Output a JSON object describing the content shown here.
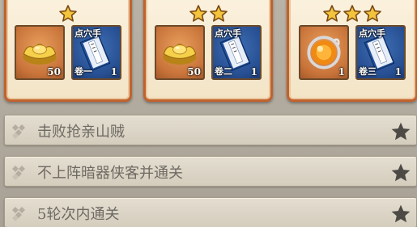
{
  "colors": {
    "card_border": "#c2612c",
    "star_gold": "#f3c43c",
    "task_text": "#6e6a63",
    "task_star": "#4d4a46"
  },
  "reward_cards": [
    {
      "stars": 1,
      "items": [
        {
          "icon": "gold-ingot-icon",
          "quantity": "50"
        },
        {
          "icon": "skill-book-icon",
          "tag": "点穴手",
          "subtitle": "卷一",
          "quantity": "1"
        }
      ]
    },
    {
      "stars": 2,
      "items": [
        {
          "icon": "gold-ingot-icon",
          "quantity": "50"
        },
        {
          "icon": "skill-book-icon",
          "tag": "点穴手",
          "subtitle": "卷二",
          "quantity": "1"
        }
      ]
    },
    {
      "stars": 3,
      "items": [
        {
          "icon": "orange-orb-icon",
          "quantity": "1"
        },
        {
          "icon": "skill-book-icon",
          "tag": "点穴手",
          "subtitle": "卷三",
          "quantity": "1"
        }
      ]
    }
  ],
  "tasks": [
    {
      "text": "击败抢亲山贼",
      "star_icon": "star-icon"
    },
    {
      "text": "不上阵暗器侠客并通关",
      "star_icon": "star-icon"
    },
    {
      "text": "5轮次内通关",
      "star_icon": "star-icon"
    }
  ]
}
